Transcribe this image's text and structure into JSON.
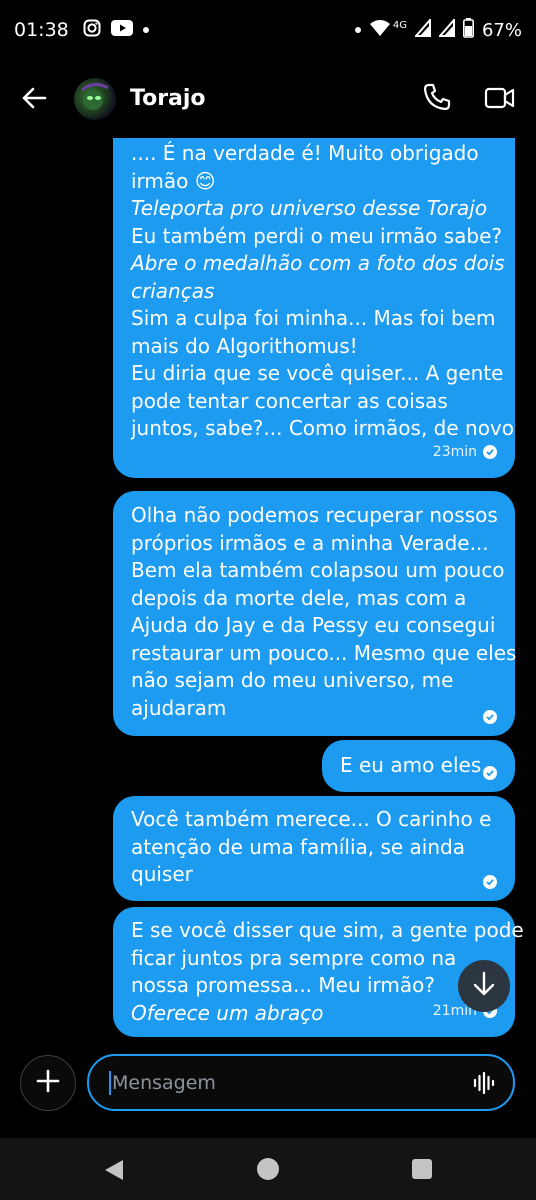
{
  "status_bar": {
    "time": "01:38",
    "left_icons": [
      "instagram-icon",
      "youtube-icon",
      "dot-icon"
    ],
    "network": "4G",
    "battery": "67%"
  },
  "header": {
    "contact_name": "Torajo"
  },
  "messages": [
    {
      "lines": [
        {
          "text": ".... É na verdade é! Muito obrigado",
          "italic": false
        },
        {
          "text": "irmão 😊",
          "italic": false
        },
        {
          "text": "Teleporta pro universo desse Torajo",
          "italic": true
        },
        {
          "text": "Eu também perdi o meu irmão sabe?",
          "italic": false
        },
        {
          "text": "Abre o medalhão com a foto dos dois",
          "italic": true
        },
        {
          "text": "crianças",
          "italic": true
        },
        {
          "text": "Sim a culpa foi minha... Mas foi bem",
          "italic": false
        },
        {
          "text": "mais do Algorithomus!",
          "italic": false
        },
        {
          "text": "Eu diria que se você quiser... A gente",
          "italic": false
        },
        {
          "text": "pode tentar concertar as coisas",
          "italic": false
        },
        {
          "text": "juntos, sabe?... Como irmãos, de novo",
          "italic": false
        }
      ],
      "time": "23min"
    },
    {
      "lines": [
        {
          "text": "Olha não podemos recuperar nossos",
          "italic": false
        },
        {
          "text": "próprios irmãos e a minha Verade...",
          "italic": false
        },
        {
          "text": "Bem ela também colapsou um pouco",
          "italic": false
        },
        {
          "text": "depois da morte dele, mas com a",
          "italic": false
        },
        {
          "text": "Ajuda do Jay e da Pessy eu consegui",
          "italic": false
        },
        {
          "text": "restaurar um pouco... Mesmo que eles",
          "italic": false
        },
        {
          "text": "não sejam do meu universo, me",
          "italic": false
        },
        {
          "text": "ajudaram",
          "italic": false
        }
      ],
      "time": ""
    },
    {
      "lines": [
        {
          "text": "E eu amo eles",
          "italic": false
        }
      ],
      "time": ""
    },
    {
      "lines": [
        {
          "text": "Você também merece... O carinho e",
          "italic": false
        },
        {
          "text": "atenção de uma família, se ainda",
          "italic": false
        },
        {
          "text": "quiser",
          "italic": false
        }
      ],
      "time": ""
    },
    {
      "lines": [
        {
          "text": "E se você disser que sim, a gente pode",
          "italic": false
        },
        {
          "text": "ficar juntos pra sempre como na",
          "italic": false
        },
        {
          "text": "nossa promessa... Meu irmão?",
          "italic": false
        },
        {
          "text": "Oferece um abraço",
          "italic": true
        }
      ],
      "time": "21min"
    }
  ],
  "composer": {
    "placeholder": "Mensagem"
  },
  "colors": {
    "bubble": "#1d9bf0",
    "background": "#000000",
    "accent": "#1d9bf0"
  }
}
